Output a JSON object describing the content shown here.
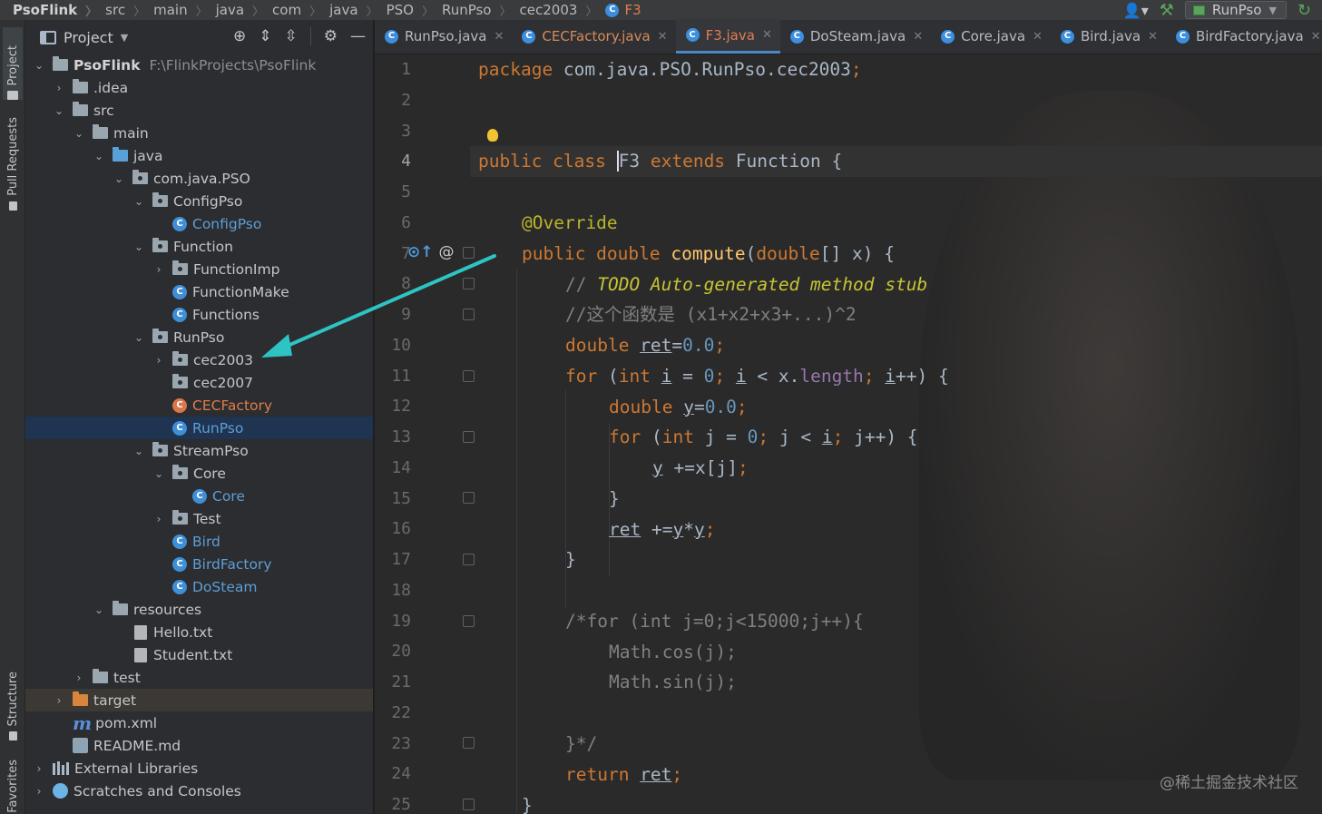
{
  "breadcrumb": {
    "items": [
      "PsoFlink",
      "src",
      "main",
      "java",
      "com",
      "java",
      "PSO",
      "RunPso",
      "cec2003",
      "F3"
    ]
  },
  "toolbar": {
    "run_config": "RunPso"
  },
  "toolstrip": {
    "tabs": [
      "Project",
      "Pull Requests",
      "Structure",
      "Favorites"
    ]
  },
  "project_panel": {
    "title": "Project",
    "root_name": "PsoFlink",
    "root_path": "F:\\FlinkProjects\\PsoFlink",
    "tree": [
      ".idea",
      "src",
      "main",
      "java",
      "com.java.PSO",
      "ConfigPso",
      "ConfigPso",
      "Function",
      "FunctionImp",
      "FunctionMake",
      "Functions",
      "RunPso",
      "cec2003",
      "cec2007",
      "CECFactory",
      "RunPso",
      "StreamPso",
      "Core",
      "Core",
      "Test",
      "Bird",
      "BirdFactory",
      "DoSteam",
      "resources",
      "Hello.txt",
      "Student.txt",
      "test",
      "target",
      "pom.xml",
      "README.md",
      "External Libraries",
      "Scratches and Consoles"
    ]
  },
  "tabs": [
    {
      "label": "RunPso.java"
    },
    {
      "label": "CECFactory.java"
    },
    {
      "label": "F3.java"
    },
    {
      "label": "DoSteam.java"
    },
    {
      "label": "Core.java"
    },
    {
      "label": "Bird.java"
    },
    {
      "label": "BirdFactory.java"
    }
  ],
  "editor": {
    "line_numbers": [
      "1",
      "2",
      "3",
      "4",
      "5",
      "6",
      "7",
      "8",
      "9",
      "10",
      "11",
      "12",
      "13",
      "14",
      "15",
      "16",
      "17",
      "18",
      "19",
      "20",
      "21",
      "22",
      "23",
      "24",
      "25"
    ],
    "code": {
      "l1_kw": "package",
      "l1_rest": " com.java.PSO.RunPso.cec2003",
      "l1_semi": ";",
      "l4_kw1": "public class ",
      "l4_f": "F",
      "l4_name": "3",
      "l4_kw2": " extends ",
      "l4_rest": "Function {",
      "l6_ann": "@Override",
      "l7_kw": "public double ",
      "l7_fn": "compute",
      "l7_p1": "(",
      "l7_kw2": "double",
      "l7_p2": "[] x) {",
      "l8_cm": "// ",
      "l8_todo": "TODO Auto-generated method stub",
      "l9_cm": "//这个函数是 (x1+x2+x3+...)^2",
      "l10_kw": "double ",
      "l10_var": "ret",
      "l10_eq": "=",
      "l10_num": "0.0",
      "l10_semi": ";",
      "l11_kw": "for ",
      "l11_p": "(",
      "l11_kw2": "int ",
      "l11_i1": "i",
      "l11_eq": " = ",
      "l11_num": "0",
      "l11_s1": "; ",
      "l11_i2": "i",
      "l11_lt": " < x.",
      "l11_len": "length",
      "l11_s2": "; ",
      "l11_i3": "i",
      "l11_end": "++) {",
      "l12_kw": "double ",
      "l12_var": "y",
      "l12_eq": "=",
      "l12_num": "0.0",
      "l12_semi": ";",
      "l13_kw": "for ",
      "l13_p": "(",
      "l13_kw2": "int ",
      "l13_a": "j = ",
      "l13_num": "0",
      "l13_s1": "; ",
      "l13_b": "j < ",
      "l13_i": "i",
      "l13_s2": "; ",
      "l13_end": "j++) {",
      "l14_var": "y",
      "l14_rest": " +=x[j]",
      "l14_semi": ";",
      "l15": "}",
      "l16_var": "ret",
      "l16_rest": " +=",
      "l16_y1": "y",
      "l16_star": "*",
      "l16_y2": "y",
      "l16_semi": ";",
      "l17": "}",
      "l19": "/*for (int j=0;j<15000;j++){",
      "l20": "Math.cos(j);",
      "l21": "Math.sin(j);",
      "l23": "}*/",
      "l24_kw": "return ",
      "l24_var": "ret",
      "l24_semi": ";",
      "l25": "}"
    }
  },
  "watermark": "@稀土掘金技术社区",
  "colors": {
    "keyword": "#cc7832",
    "string_annotation": "#bbb529",
    "number": "#6897bb",
    "accent_blue": "#4a88c7",
    "annotation_arrow": "#2ec4c4"
  }
}
